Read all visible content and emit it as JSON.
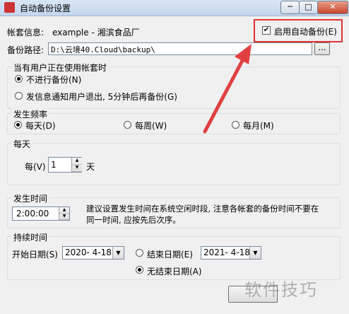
{
  "window": {
    "title": "自动备份设置",
    "controls": {
      "minimize": "─",
      "maximize": "□",
      "close": "✕"
    }
  },
  "account": {
    "label": "帐套信息:",
    "value": "example - 湘滨食品厂"
  },
  "auto_backup": {
    "label": "启用自动备份(E)",
    "checked": true
  },
  "backup_path": {
    "label": "备份路径:",
    "value": "D:\\云境40.Cloud\\backup\\",
    "browse": "..."
  },
  "in_use": {
    "title": "当有用户正在使用帐套时",
    "options": [
      {
        "label": "不进行备份(N)",
        "selected": true
      },
      {
        "label": "发信息通知用户退出, 5分钟后再备份(G)",
        "selected": false
      }
    ]
  },
  "frequency": {
    "title": "发生频率",
    "options": [
      {
        "label": "每天(D)",
        "selected": true
      },
      {
        "label": "每周(W)",
        "selected": false
      },
      {
        "label": "每月(M)",
        "selected": false
      }
    ]
  },
  "daily": {
    "title": "每天",
    "prefix": "每(V)",
    "value": "1",
    "suffix": "天"
  },
  "time": {
    "title": "发生时间",
    "value": "2:00:00",
    "hint": "建议设置发生时间在系统空闲时段, 注意各帐套的备份时间不要在同一时间, 应按先后次序。"
  },
  "duration": {
    "title": "持续时间",
    "start_label": "开始日期(S)",
    "start_value": "2020- 4-18",
    "end_label": "结束日期(E)",
    "end_value": "2021- 4-18",
    "no_end_label": "无结束日期(A)",
    "no_end_selected": true,
    "end_selected": false
  },
  "watermark": "软件技巧",
  "colors": {
    "highlight": "#e03434",
    "arrow": "#e04040"
  }
}
